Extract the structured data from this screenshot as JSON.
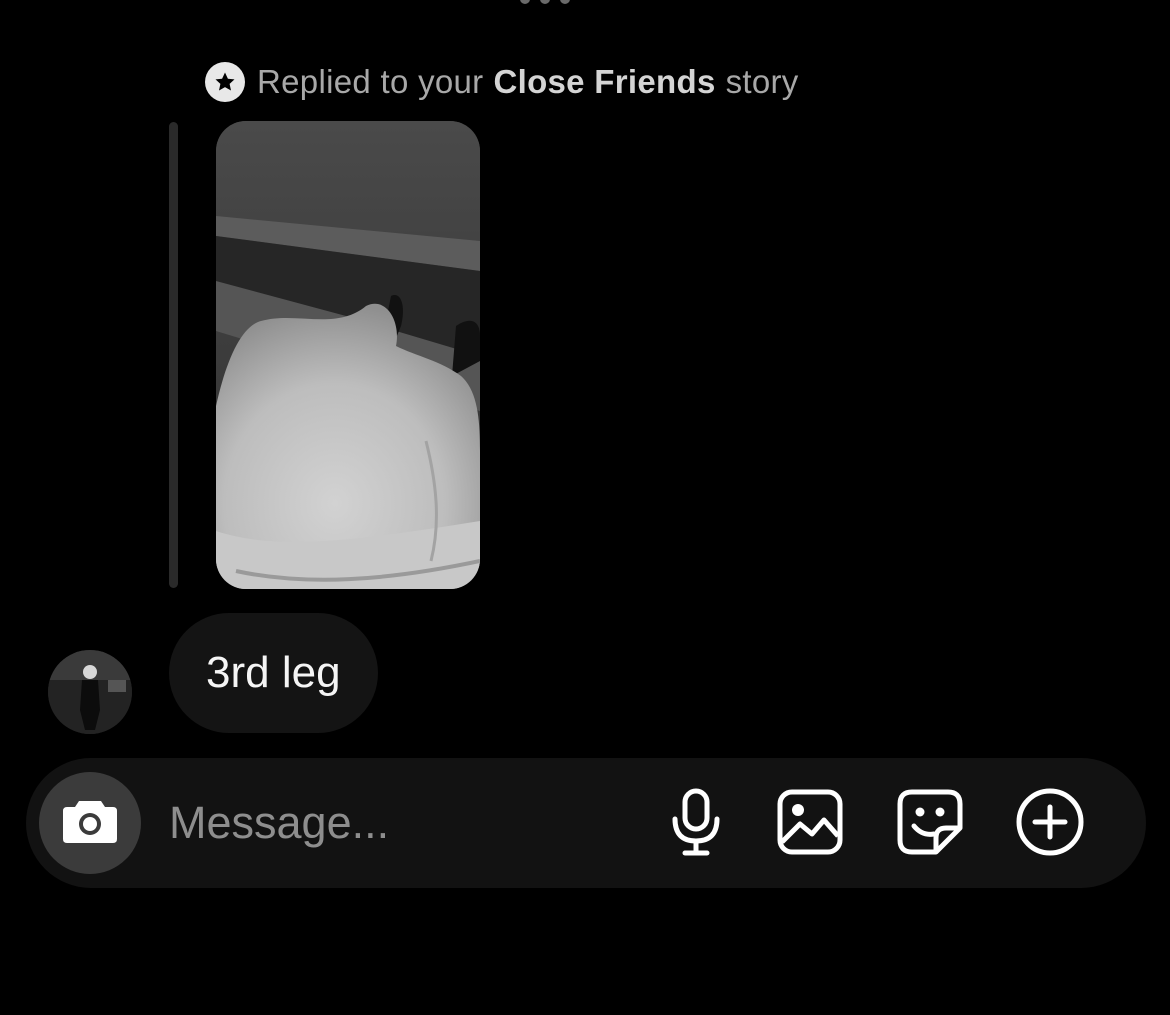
{
  "reply_header": {
    "prefix": "Replied to your",
    "highlight": "Close Friends",
    "suffix": "story",
    "badge_icon": "star-icon"
  },
  "message": {
    "text": "3rd leg"
  },
  "composer": {
    "placeholder": "Message...",
    "icons": [
      "camera-icon",
      "microphone-icon",
      "gallery-icon",
      "sticker-icon",
      "plus-circle-icon"
    ]
  },
  "colors": {
    "background": "#000000",
    "bubble": "#141414",
    "composer": "#121212",
    "camera_button": "#3b3b3b",
    "muted_text": "#a8a8a8"
  }
}
